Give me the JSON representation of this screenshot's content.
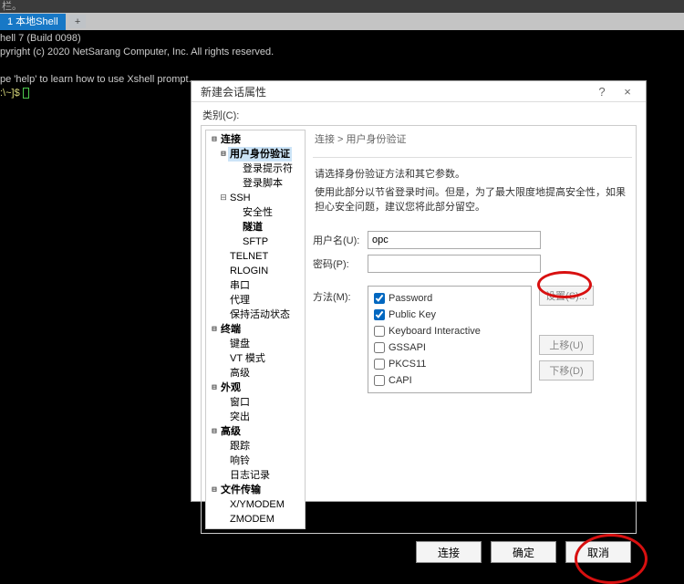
{
  "window": {
    "truncated_title": "栏。"
  },
  "tab": {
    "label": "1 本地Shell",
    "add": "+"
  },
  "terminal": {
    "line1": "hell 7 (Build 0098)",
    "line2": "pyright (c) 2020 NetSarang Computer, Inc. All rights reserved.",
    "blank": "",
    "line3": "pe 'help' to learn how to use Xshell prompt.",
    "prompt_prefix": ":\\~]$ "
  },
  "dialog": {
    "title": "新建会话属性",
    "help": "?",
    "close": "×",
    "category_label": "类别(C):",
    "breadcrumb": "连接 > 用户身份验证",
    "desc1": "请选择身份验证方法和其它参数。",
    "desc2": "使用此部分以节省登录时间。但是，为了最大限度地提高安全性，如果担心安全问题，建议您将此部分留空。",
    "username_label": "用户名(U):",
    "username_value": "opc",
    "password_label": "密码(P):",
    "password_value": "",
    "method_label": "方法(M):",
    "methods": {
      "password": {
        "label": "Password",
        "checked": true
      },
      "publickey": {
        "label": "Public Key",
        "checked": true
      },
      "kbd": {
        "label": "Keyboard Interactive",
        "checked": false
      },
      "gssapi": {
        "label": "GSSAPI",
        "checked": false
      },
      "pkcs11": {
        "label": "PKCS11",
        "checked": false
      },
      "capi": {
        "label": "CAPI",
        "checked": false
      }
    },
    "btn_setup": "设置(S)...",
    "btn_up": "上移(U)",
    "btn_down": "下移(D)",
    "btn_connect": "连接",
    "btn_ok": "确定",
    "btn_cancel": "取消"
  },
  "tree": {
    "connection": "连接",
    "auth": "用户身份验证",
    "login_prompt": "登录提示符",
    "login_script": "登录脚本",
    "ssh": "SSH",
    "security": "安全性",
    "tunnel": "隧道",
    "sftp": "SFTP",
    "telnet": "TELNET",
    "rlogin": "RLOGIN",
    "serial": "串口",
    "proxy": "代理",
    "keepalive": "保持活动状态",
    "terminal": "终端",
    "keyboard": "键盘",
    "vt": "VT 模式",
    "advanced2": "高级",
    "appearance": "外观",
    "window": "窗口",
    "highlight": "突出",
    "advanced": "高级",
    "trace": "跟踪",
    "bell": "响铃",
    "log": "日志记录",
    "filetrans": "文件传输",
    "xymodem": "X/YMODEM",
    "zmodem": "ZMODEM"
  }
}
